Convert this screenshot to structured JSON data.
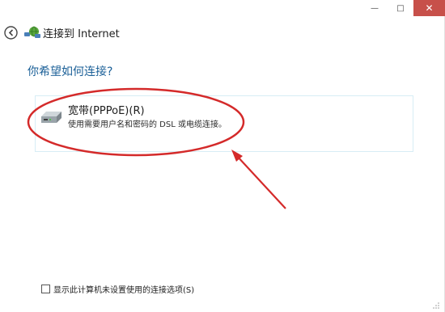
{
  "window": {
    "caption_buttons": {
      "minimize": "—",
      "maximize": "□",
      "close": "✕"
    }
  },
  "header": {
    "title": "连接到 Internet",
    "back_icon": "back-arrow-icon",
    "network_icon": "network-globe-icon"
  },
  "main": {
    "question": "你希望如何连接?",
    "options": [
      {
        "title": "宽带(PPPoE)(R)",
        "description": "使用需要用户名和密码的 DSL 或电缆连接。",
        "icon": "broadband-drive-icon"
      }
    ]
  },
  "footer": {
    "checkbox_label": "显示此计算机未设置使用的连接选项(S)",
    "checkbox_checked": false
  },
  "colors": {
    "question_text": "#1a5f97",
    "annotation_red": "#d42a2a",
    "close_button": "#c7504a"
  }
}
